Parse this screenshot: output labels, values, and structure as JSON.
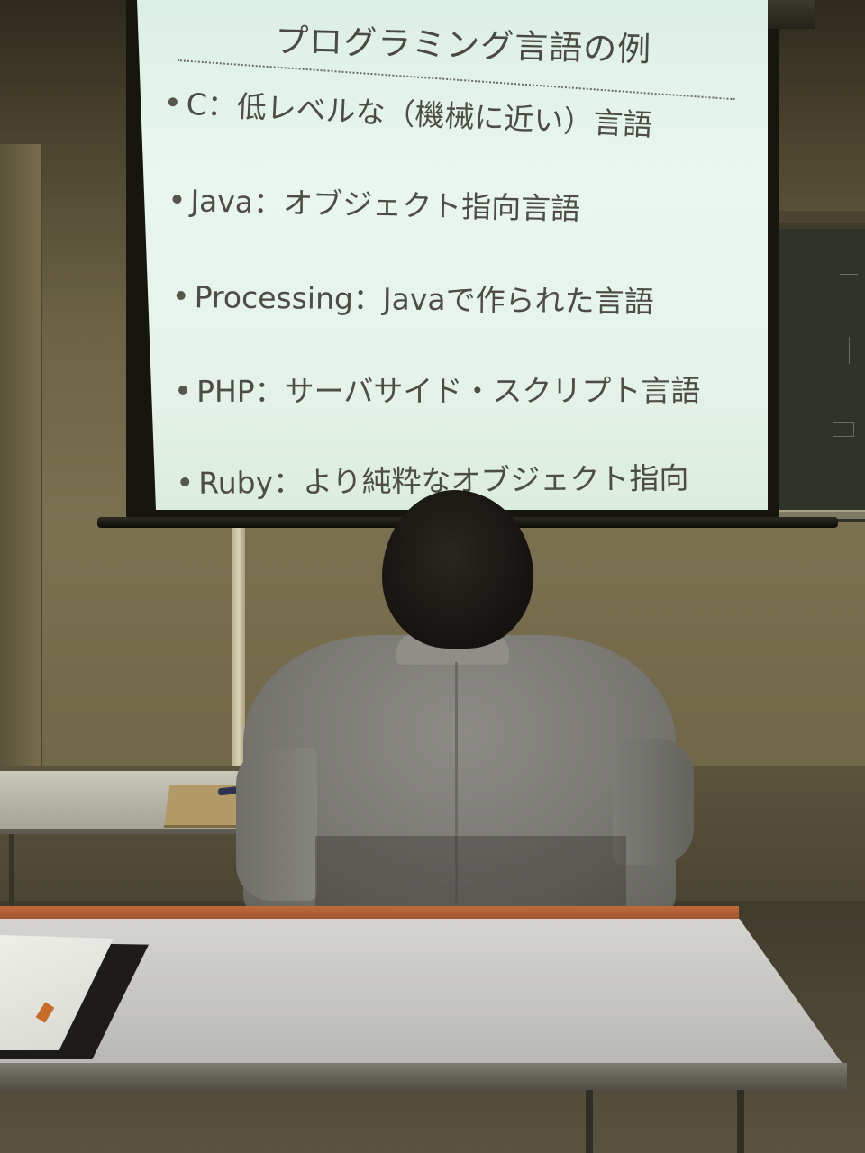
{
  "slide": {
    "title": "プログラミング言語の例",
    "bullets": [
      "C：低レベルな（機械に近い）言語",
      "Java：オブジェクト指向言語",
      "Processing：Javaで作られた言語",
      "PHP：サーバサイド・スクリプト言語",
      "Ruby：より純粋なオブジェクト指向"
    ]
  }
}
